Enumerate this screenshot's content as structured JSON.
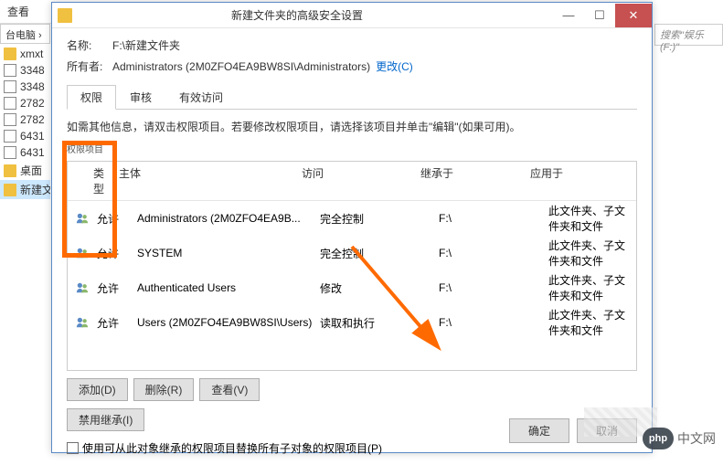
{
  "bg": {
    "toolbar_label": "查看",
    "breadcrumb": "台电脑 ›",
    "search_placeholder": "搜索\"娱乐 (F:)\"",
    "sidebar": [
      {
        "icon": "folder",
        "label": "xmxt"
      },
      {
        "icon": "blank",
        "label": "3348"
      },
      {
        "icon": "blank",
        "label": "3348"
      },
      {
        "icon": "blank",
        "label": "2782"
      },
      {
        "icon": "blank",
        "label": "2782"
      },
      {
        "icon": "blank",
        "label": "6431"
      },
      {
        "icon": "blank",
        "label": "6431"
      },
      {
        "icon": "folder",
        "label": "桌面",
        "highlight": true
      },
      {
        "icon": "folder",
        "label": "新建文",
        "selected": true
      }
    ]
  },
  "dialog": {
    "title": "新建文件夹的高级安全设置",
    "name_label": "名称:",
    "name_value": "F:\\新建文件夹",
    "owner_label": "所有者:",
    "owner_value": "Administrators (2M0ZFO4EA9BW8SI\\Administrators)",
    "change_link": "更改(C)",
    "tabs": [
      "权限",
      "审核",
      "有效访问"
    ],
    "hint": "如需其他信息，请双击权限项目。若要修改权限项目，请选择该项目并单击\"编辑\"(如果可用)。",
    "small_label": "权限项目",
    "headers": {
      "type": "类型",
      "principal": "主体",
      "access": "访问",
      "inherited": "继承于",
      "applies": "应用于"
    },
    "rows": [
      {
        "type": "允许",
        "principal": "Administrators (2M0ZFO4EA9B...",
        "access": "完全控制",
        "inherited": "F:\\",
        "applies": "此文件夹、子文件夹和文件"
      },
      {
        "type": "允许",
        "principal": "SYSTEM",
        "access": "完全控制",
        "inherited": "F:\\",
        "applies": "此文件夹、子文件夹和文件"
      },
      {
        "type": "允许",
        "principal": "Authenticated Users",
        "access": "修改",
        "inherited": "F:\\",
        "applies": "此文件夹、子文件夹和文件"
      },
      {
        "type": "允许",
        "principal": "Users (2M0ZFO4EA9BW8SI\\Users)",
        "access": "读取和执行",
        "inherited": "F:\\",
        "applies": "此文件夹、子文件夹和文件"
      }
    ],
    "buttons": {
      "add": "添加(D)",
      "remove": "删除(R)",
      "view": "查看(V)",
      "disable_inherit": "禁用继承(I)"
    },
    "checkbox_label": "使用可从此对象继承的权限项目替换所有子对象的权限项目(P)",
    "ok": "确定",
    "cancel": "取消"
  },
  "watermark": {
    "logo": "php",
    "text": "中文网"
  }
}
